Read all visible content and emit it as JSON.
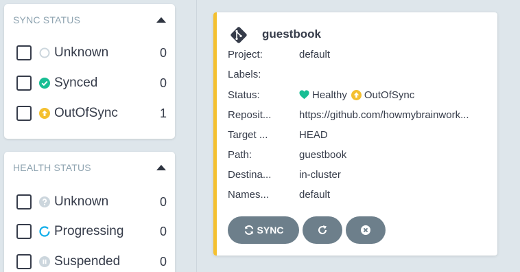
{
  "sidebar": {
    "sync_status": {
      "header": "SYNC STATUS",
      "items": [
        {
          "label": "Unknown",
          "count": "0",
          "icon": "unknown-circle-icon"
        },
        {
          "label": "Synced",
          "count": "0",
          "icon": "check-circle-icon"
        },
        {
          "label": "OutOfSync",
          "count": "1",
          "icon": "arrow-up-circle-icon"
        }
      ]
    },
    "health_status": {
      "header": "HEALTH STATUS",
      "items": [
        {
          "label": "Unknown",
          "count": "0",
          "icon": "question-circle-icon"
        },
        {
          "label": "Progressing",
          "count": "0",
          "icon": "progress-circle-icon"
        },
        {
          "label": "Suspended",
          "count": "0",
          "icon": "pause-circle-icon"
        }
      ]
    }
  },
  "app": {
    "name": "guestbook",
    "fields": [
      {
        "key": "Project:",
        "value": "default"
      },
      {
        "key": "Labels:",
        "value": ""
      },
      {
        "key": "Status:",
        "health": "Healthy",
        "sync": "OutOfSync"
      },
      {
        "key": "Reposit...",
        "value": "https://github.com/howmybrainwork..."
      },
      {
        "key": "Target ...",
        "value": "HEAD"
      },
      {
        "key": "Path:",
        "value": "guestbook"
      },
      {
        "key": "Destina...",
        "value": "in-cluster"
      },
      {
        "key": "Names...",
        "value": "default"
      }
    ],
    "actions": {
      "sync_label": "SYNC"
    }
  },
  "colors": {
    "synced": "#18be94",
    "out_of_sync": "#f4c030",
    "healthy": "#18be94",
    "progressing": "#0dadea",
    "unknown": "#ccd6dd",
    "button": "#6d7f8b",
    "card_accent": "#f4c030"
  }
}
